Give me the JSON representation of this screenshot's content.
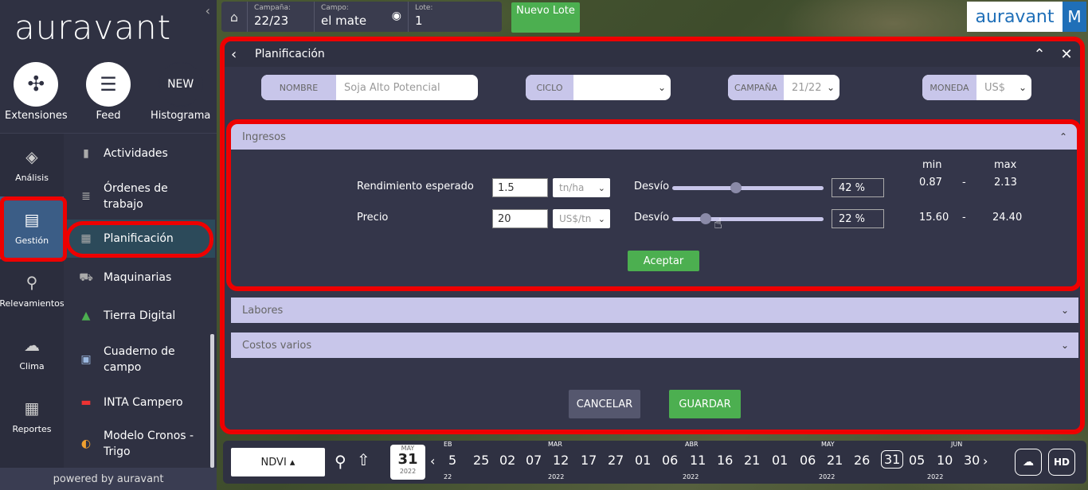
{
  "brand": "auravant",
  "sidebar": {
    "tiles": [
      {
        "label": "Extensiones",
        "icon": "puzzle-icon",
        "glyph": "✣"
      },
      {
        "label": "Feed",
        "icon": "feed-icon",
        "glyph": "☰"
      },
      {
        "label": "Histograma",
        "icon": "new-icon",
        "glyph": "NEW"
      }
    ],
    "rail": [
      {
        "label": "Análisis",
        "icon": "layers-icon",
        "glyph": "◈"
      },
      {
        "label": "Gestión",
        "icon": "clipboard-icon",
        "glyph": "▤"
      },
      {
        "label": "Relevamientos",
        "icon": "location-pin-icon",
        "glyph": "⚲"
      },
      {
        "label": "Clima",
        "icon": "cloud-icon",
        "glyph": "☁"
      },
      {
        "label": "Reportes",
        "icon": "report-icon",
        "glyph": "▦"
      }
    ],
    "submenu": [
      {
        "label": "Actividades",
        "icon": "book-icon",
        "glyph": "▮"
      },
      {
        "label": "Órdenes de trabajo",
        "icon": "stack-icon",
        "glyph": "≣"
      },
      {
        "label": "Planificación",
        "icon": "calendar-icon",
        "glyph": "▦"
      },
      {
        "label": "Maquinarias",
        "icon": "tractor-icon",
        "glyph": "⛟"
      },
      {
        "label": "Tierra Digital",
        "icon": "triangle-logo-icon",
        "glyph": "▲"
      },
      {
        "label": "Cuaderno de campo",
        "icon": "notebook-icon",
        "glyph": "▣"
      },
      {
        "label": "INTA Campero",
        "icon": "inta-logo-icon",
        "glyph": "▬"
      },
      {
        "label": "Modelo Cronos - Trigo",
        "icon": "cronos-icon",
        "glyph": "◐"
      }
    ],
    "powered": "powered by auravant"
  },
  "topbar": {
    "campana_label": "Campaña:",
    "campana_value": "22/23",
    "campo_label": "Campo:",
    "campo_value": "el mate",
    "lote_label": "Lote:",
    "lote_value": "1",
    "nuevo_lote": "Nuevo Lote",
    "logo": "auravant",
    "avatar": "M"
  },
  "modal": {
    "title": "Planificación",
    "filters": {
      "nombre_label": "NOMBRE",
      "nombre_value": "Soja Alto Potencial",
      "ciclo_label": "CICLO",
      "ciclo_value": "",
      "campana_label": "CAMPAÑA",
      "campana_value": "21/22",
      "moneda_label": "MONEDA",
      "moneda_value": "US$"
    },
    "ingresos": {
      "title": "Ingresos",
      "min_label": "min",
      "max_label": "max",
      "rows": [
        {
          "label": "Rendimiento esperado",
          "value": "1.5",
          "unit": "tn/ha",
          "desvio_label": "Desvío",
          "pct": "42 %",
          "desvio": 0.42,
          "min": "0.87",
          "dash": "-",
          "max": "2.13"
        },
        {
          "label": "Precio",
          "value": "20",
          "unit": "US$/tn",
          "desvio_label": "Desvío",
          "pct": "22 %",
          "desvio": 0.22,
          "min": "15.60",
          "dash": "-",
          "max": "24.40"
        }
      ],
      "aceptar": "Aceptar"
    },
    "labores": "Labores",
    "costos": "Costos varios",
    "cancelar": "CANCELAR",
    "guardar": "GUARDAR"
  },
  "bottombar": {
    "layer": "NDVI ▴",
    "date_month": "MAY",
    "date_day": "31",
    "date_year": "2022",
    "months": [
      "EB",
      "MAR",
      "ABR",
      "MAY",
      "JUN"
    ],
    "years": [
      "22",
      "2022",
      "2022",
      "2022",
      "2022"
    ],
    "days": [
      "5",
      "25",
      "02",
      "07",
      "12",
      "17",
      "27",
      "01",
      "06",
      "11",
      "16",
      "21",
      "01",
      "06",
      "21",
      "26",
      "31",
      "05",
      "10",
      "30"
    ],
    "selected_day_index": 16,
    "hd": "HD"
  },
  "colors": {
    "highlight": "#e00000",
    "accent_green": "#4caf50",
    "sidebar_bg": "#2f3142",
    "section_bar": "#c8c6ea",
    "active_blue": "#3b5d86"
  }
}
